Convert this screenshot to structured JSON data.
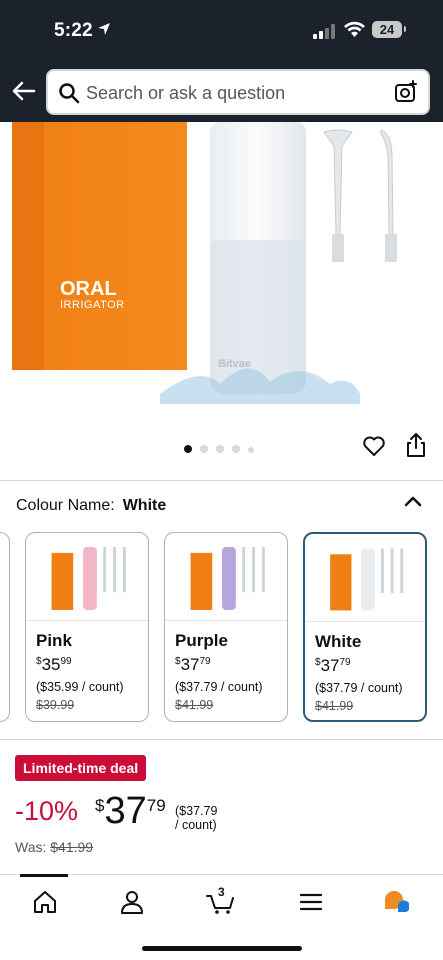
{
  "status_bar": {
    "time": "5:22",
    "battery": "24"
  },
  "header": {
    "search_placeholder": "Search or ask a question"
  },
  "product_image": {
    "box_title": "ORAL",
    "box_subtitle": "IRRIGATOR",
    "brand": "Bitvae",
    "carousel_dots": 5,
    "active_dot": 0
  },
  "colour": {
    "label": "Colour Name:",
    "selected": "White",
    "options": [
      {
        "name": "Pink",
        "price_currency": "$",
        "price_whole": "35",
        "price_cents": "99",
        "unit": "($35.99 / count)",
        "was": "$39.99",
        "swatch": "#f2b6c6",
        "selected": false
      },
      {
        "name": "Purple",
        "price_currency": "$",
        "price_whole": "37",
        "price_cents": "79",
        "unit": "($37.79 / count)",
        "was": "$41.99",
        "swatch": "#b6a6de",
        "selected": false
      },
      {
        "name": "White",
        "price_currency": "$",
        "price_whole": "37",
        "price_cents": "79",
        "unit": "($37.79 / count)",
        "was": "$41.99",
        "swatch": "#e9edf0",
        "selected": true
      }
    ]
  },
  "deal": {
    "badge": "Limited-time deal",
    "discount": "-10%",
    "currency": "$",
    "price_whole": "37",
    "price_cents": "79",
    "per_unit": "($37.79 / count)",
    "was_label": "Was:",
    "was_price": "$41.99"
  },
  "tabbar": {
    "cart_count": "3"
  },
  "colors": {
    "deal_red": "#cc0c39",
    "selected_border": "#2c5b7a",
    "header_bg": "#1c222b",
    "box_orange": "#f07f14"
  }
}
